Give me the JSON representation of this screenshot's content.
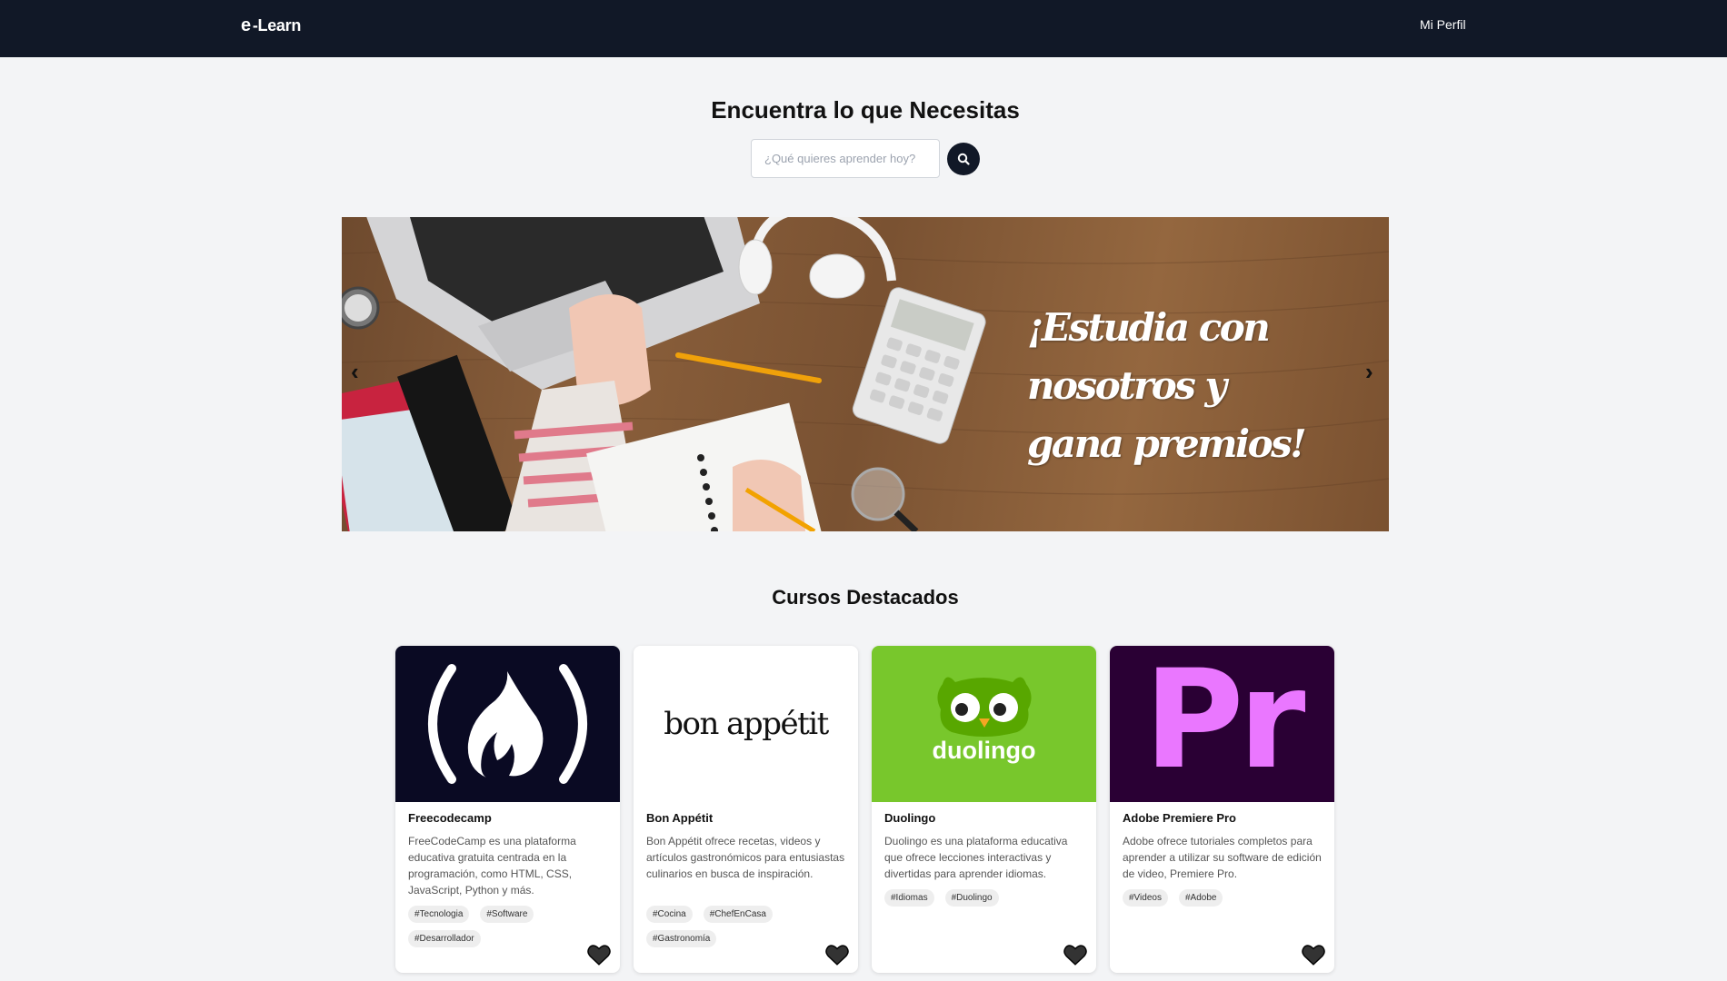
{
  "navbar": {
    "brand_glyph": "e",
    "brand_text": "-Learn",
    "profile_label": "Mi Perfil"
  },
  "search": {
    "title": "Encuentra lo que Necesitas",
    "placeholder": "¿Qué quieres aprender hoy?",
    "button_icon": "search-icon"
  },
  "banner": {
    "lines": [
      "¡Estudia con",
      "nosotros y",
      "gana premios!"
    ],
    "prev_arrow": "‹",
    "next_arrow": "›"
  },
  "featured": {
    "title": "Cursos Destacados",
    "courses": [
      {
        "name": "Freecodecamp",
        "description": "FreeCodeCamp es una plataforma educativa gratuita centrada en la programación, como HTML, CSS, JavaScript, Python y más.",
        "tags": [
          "#Tecnologia",
          "#Software",
          "#Desarrollador"
        ],
        "logo_text": "( 🔥 )",
        "bg_color": "#0a0a23"
      },
      {
        "name": "Bon Appétit",
        "description": "Bon Appétit ofrece recetas, videos y artículos gastronómicos para entusiastas culinarios en busca de inspiración.",
        "tags": [
          "#Cocina",
          "#ChefEnCasa",
          "#Gastronomía"
        ],
        "logo_text": "bon appétit",
        "bg_color": "#ffffff"
      },
      {
        "name": "Duolingo",
        "description": "Duolingo es una plataforma educativa que ofrece lecciones interactivas y divertidas para aprender idiomas.",
        "tags": [
          "#Idiomas",
          "#Duolingo"
        ],
        "logo_text": "duolingo",
        "bg_color": "#78c72c"
      },
      {
        "name": "Adobe Premiere Pro",
        "description": "Adobe ofrece tutoriales completos para aprender a utilizar su software de edición de video, Premiere Pro.",
        "tags": [
          "#Videos",
          "#Adobe"
        ],
        "logo_text": "Pr",
        "bg_color": "#2a0034"
      }
    ]
  }
}
